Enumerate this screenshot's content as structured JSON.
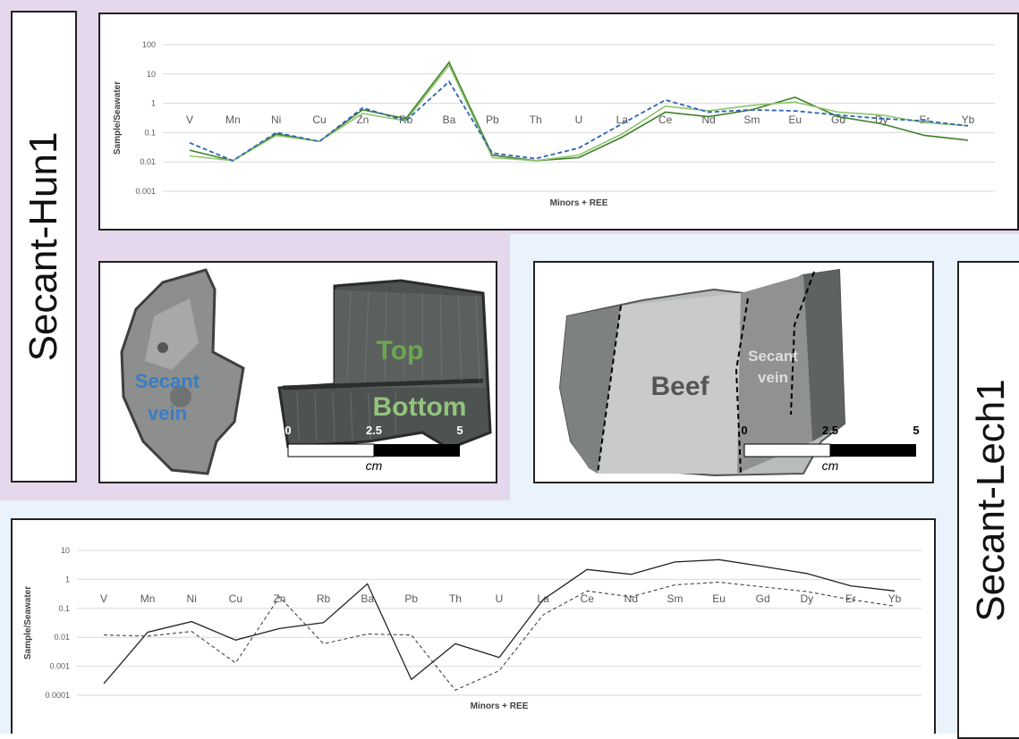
{
  "labels": {
    "left": "Secant-Hun1",
    "right": "Secant-Lech1"
  },
  "photos": {
    "left": {
      "secant": "Secant",
      "vein": "vein",
      "top": "Top",
      "bottom": "Bottom",
      "scale": {
        "ticks": [
          "0",
          "2.5",
          "5"
        ],
        "unit": "cm"
      }
    },
    "right": {
      "beef": "Beef",
      "secant": "Secant",
      "vein": "vein",
      "scale": {
        "ticks": [
          "0",
          "2.5",
          "5"
        ],
        "unit": "cm"
      }
    }
  },
  "colors": {
    "bottom_series": "#3f7f2a",
    "top_series": "#8ec46b",
    "secant_series": "#2f63b8",
    "lech_solid": "#222222",
    "lech_dashed": "#444444",
    "label_secant_blue": "#3a7cc4",
    "label_top_green": "#6aa84f",
    "label_bottom_green": "#93c47d"
  },
  "chart_data": [
    {
      "type": "line",
      "scale": "log",
      "categories": [
        "V",
        "Mn",
        "Ni",
        "Cu",
        "Zn",
        "Rb",
        "Ba",
        "Pb",
        "Th",
        "U",
        "La",
        "Ce",
        "Nd",
        "Sm",
        "Eu",
        "Gd",
        "Dy",
        "Er",
        "Yb"
      ],
      "yticks": [
        "100",
        "10",
        "1",
        "0.1",
        "0.01",
        "0.001"
      ],
      "ylim": [
        0.001,
        100
      ],
      "xlabel": "Minors + REE",
      "ylabel": "Sample/Seawater",
      "series": [
        {
          "values": [
            0.025,
            0.011,
            0.09,
            0.05,
            0.6,
            0.3,
            25,
            0.017,
            0.011,
            0.014,
            0.07,
            0.5,
            0.35,
            0.6,
            1.6,
            0.35,
            0.2,
            0.08,
            0.055
          ],
          "style": "solid-dark"
        },
        {
          "values": [
            0.016,
            0.011,
            0.08,
            0.05,
            0.45,
            0.25,
            20,
            0.014,
            0.011,
            0.017,
            0.09,
            0.8,
            0.55,
            0.85,
            1.1,
            0.5,
            0.4,
            0.22,
            0.17
          ],
          "style": "solid-light"
        },
        {
          "values": [
            0.045,
            0.011,
            0.1,
            0.05,
            0.7,
            0.25,
            5.5,
            0.02,
            0.013,
            0.03,
            0.2,
            1.3,
            0.5,
            0.6,
            0.55,
            0.4,
            0.3,
            0.25,
            0.17
          ],
          "style": "dashed-blue"
        }
      ]
    },
    {
      "type": "line",
      "scale": "log",
      "categories": [
        "V",
        "Mn",
        "Ni",
        "Cu",
        "Zn",
        "Rb",
        "Ba",
        "Pb",
        "Th",
        "U",
        "La",
        "Ce",
        "Nd",
        "Sm",
        "Eu",
        "Gd",
        "Dy",
        "Er",
        "Yb"
      ],
      "yticks": [
        "10",
        "1",
        "0.1",
        "0.01",
        "0.001",
        "0.0001"
      ],
      "ylim": [
        0.0001,
        10
      ],
      "xlabel": "Minors + REE",
      "ylabel": "Sample/Seawater",
      "series": [
        {
          "values": [
            0.00025,
            0.015,
            0.035,
            0.008,
            0.02,
            0.032,
            0.7,
            0.00035,
            0.006,
            0.002,
            0.2,
            2.2,
            1.5,
            4,
            4.8,
            2.8,
            1.6,
            0.6,
            0.4
          ],
          "style": "solid-black"
        },
        {
          "values": [
            0.012,
            0.011,
            0.016,
            0.0013,
            0.25,
            0.006,
            0.013,
            0.012,
            0.00015,
            0.0007,
            0.06,
            0.4,
            0.25,
            0.65,
            0.8,
            0.55,
            0.38,
            0.2,
            0.12
          ],
          "style": "dashed-black"
        }
      ]
    }
  ]
}
